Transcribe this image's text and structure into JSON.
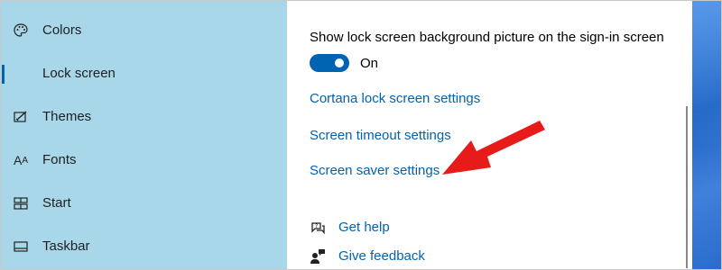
{
  "sidebar": {
    "items": [
      {
        "label": "Colors",
        "icon": "palette-icon"
      },
      {
        "label": "Lock screen",
        "icon": "lock-screen-icon"
      },
      {
        "label": "Themes",
        "icon": "themes-icon"
      },
      {
        "label": "Fonts",
        "icon": "fonts-icon"
      },
      {
        "label": "Start",
        "icon": "start-icon"
      },
      {
        "label": "Taskbar",
        "icon": "taskbar-icon"
      }
    ],
    "selected": "Lock screen",
    "fonts_icon_glyph": "A"
  },
  "main": {
    "setting_label": "Show lock screen background picture on the sign-in screen",
    "toggle_state": "On",
    "links": [
      "Cortana lock screen settings",
      "Screen timeout settings",
      "Screen saver settings"
    ],
    "help": {
      "get_help": "Get help",
      "give_feedback": "Give feedback"
    }
  },
  "colors": {
    "sidebar_bg": "#a9d7ea",
    "accent": "#0063b1",
    "arrow": "#e81b1b"
  }
}
